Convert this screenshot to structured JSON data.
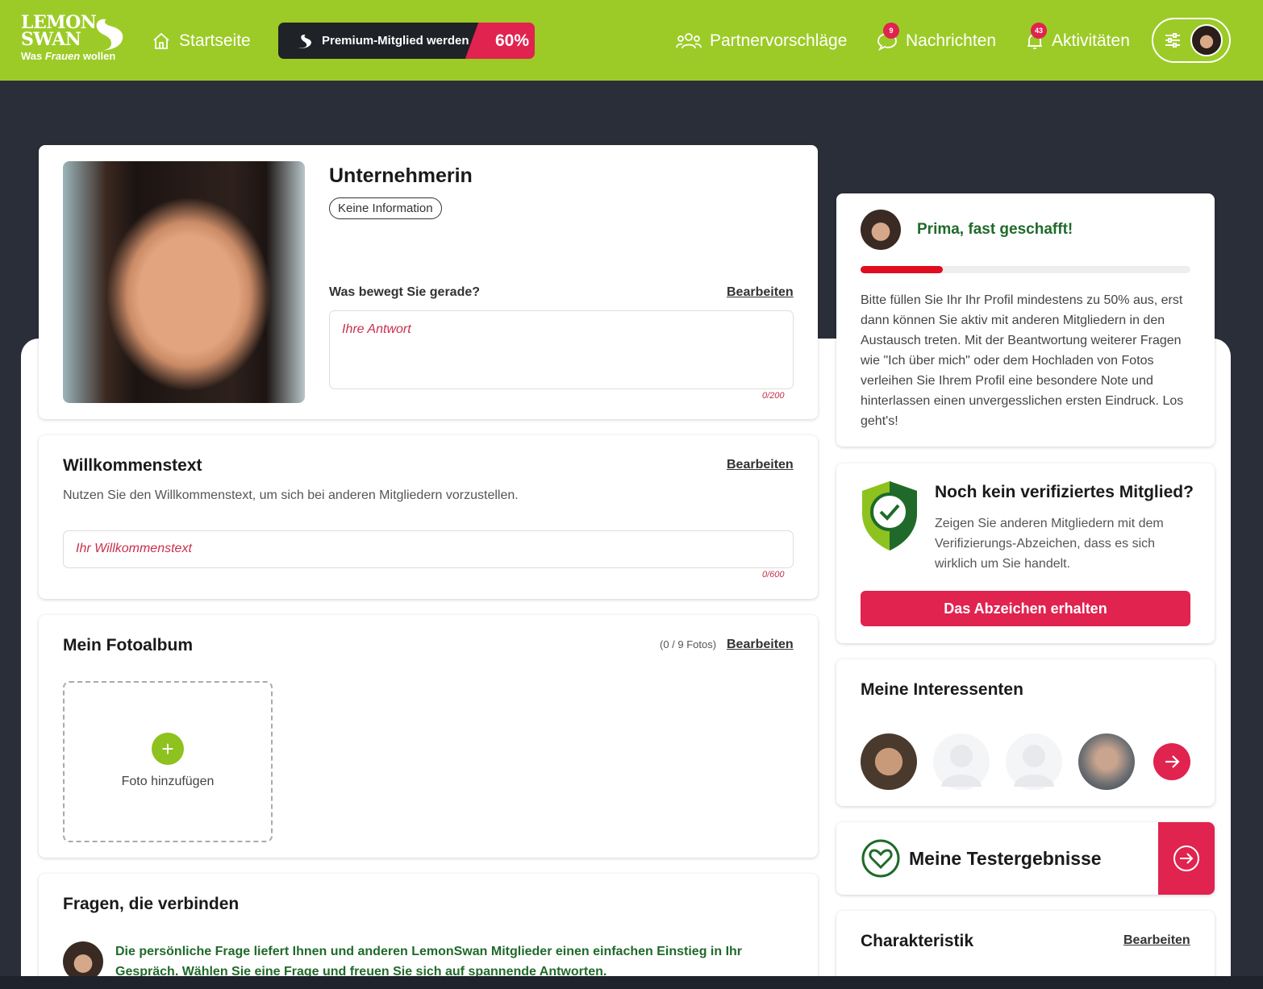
{
  "header": {
    "logo_line1": "LEMON",
    "logo_line2": "SWAN",
    "logo_tag_pre": "Was ",
    "logo_tag_em": "Frauen",
    "logo_tag_post": " wollen",
    "nav_home": "Startseite",
    "premium_label": "Premium-Mitglied werden",
    "premium_pct": "60%",
    "nav_suggestions": "Partnervorschläge",
    "nav_messages": "Nachrichten",
    "messages_count": "9",
    "nav_activities": "Aktivitäten",
    "activities_count": "43"
  },
  "profile": {
    "occupation": "Unternehmerin",
    "info_pill": "Keine Information",
    "question": "Was bewegt Sie gerade?",
    "edit": "Bearbeiten",
    "answer_placeholder": "Ihre Antwort",
    "answer_counter": "0/200"
  },
  "welcome": {
    "title": "Willkommenstext",
    "edit": "Bearbeiten",
    "description": "Nutzen Sie den Willkommenstext, um sich bei anderen Mitgliedern vorzustellen.",
    "placeholder": "Ihr Willkommenstext",
    "counter": "0/600"
  },
  "album": {
    "title": "Mein Fotoalbum",
    "count": "(0 / 9 Fotos)",
    "edit": "Bearbeiten",
    "add_photo": "Foto hinzufügen"
  },
  "questions": {
    "title": "Fragen, die verbinden",
    "text": "Die persönliche Frage liefert Ihnen und anderen LemonSwan Mitglieder einen einfachen Einstieg in Ihr Gespräch. Wählen Sie eine Frage und freuen Sie sich auf spannende Antworten."
  },
  "completion": {
    "title": "Prima, fast geschafft!",
    "progress": 0.25,
    "text": "Bitte füllen Sie Ihr Ihr Profil mindestens zu 50% aus, erst dann können Sie aktiv mit anderen Mitgliedern in den Austausch treten. Mit der Beantwortung weiterer Fragen wie \"Ich über mich\" oder dem Hochladen von Fotos verleihen Sie Ihrem Profil eine besondere Note und hinterlassen einen unvergesslichen ersten Eindruck. Los geht's!"
  },
  "verify": {
    "title": "Noch kein verifiziertes Mitglied?",
    "text": "Zeigen Sie anderen Mitgliedern mit dem Verifizierungs-Abzeichen, dass es sich wirklich um Sie handelt.",
    "button": "Das Abzeichen erhalten"
  },
  "interested": {
    "title": "Meine Interessenten"
  },
  "tests": {
    "title": "Meine Testergebnisse"
  },
  "character": {
    "title": "Charakteristik",
    "edit": "Bearbeiten"
  },
  "colors": {
    "brand_green": "#9ccb27",
    "accent_red": "#e0234f",
    "dark_green": "#1f6a2a"
  }
}
